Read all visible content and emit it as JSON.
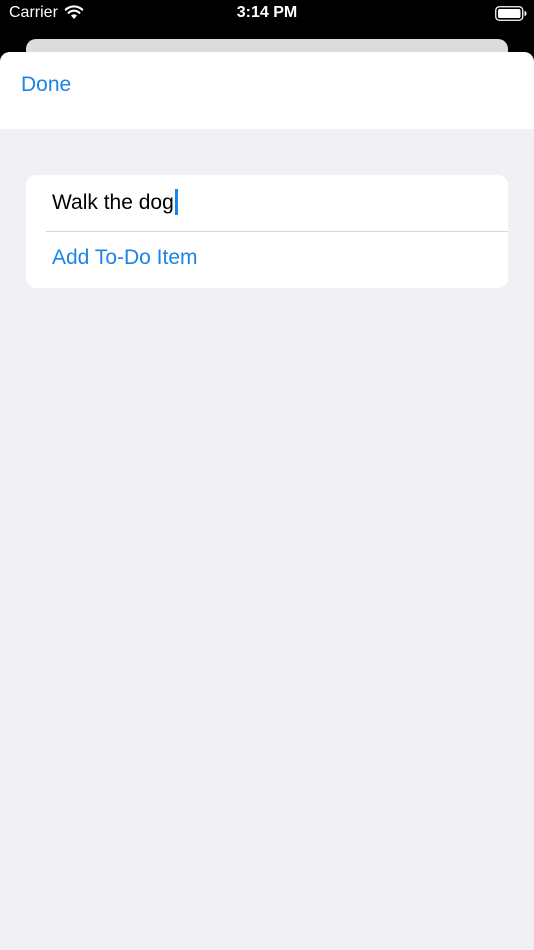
{
  "status_bar": {
    "carrier": "Carrier",
    "time": "3:14 PM",
    "wifi_icon": "wifi-icon",
    "battery_icon": "battery-icon"
  },
  "nav": {
    "done_label": "Done"
  },
  "form": {
    "input_value": "Walk the dog",
    "add_label": "Add To-Do Item"
  },
  "colors": {
    "accent": "#1a84e8",
    "sheet_background": "#f1f1f5",
    "card_background": "#ffffff",
    "status_bar_background": "#000000"
  }
}
